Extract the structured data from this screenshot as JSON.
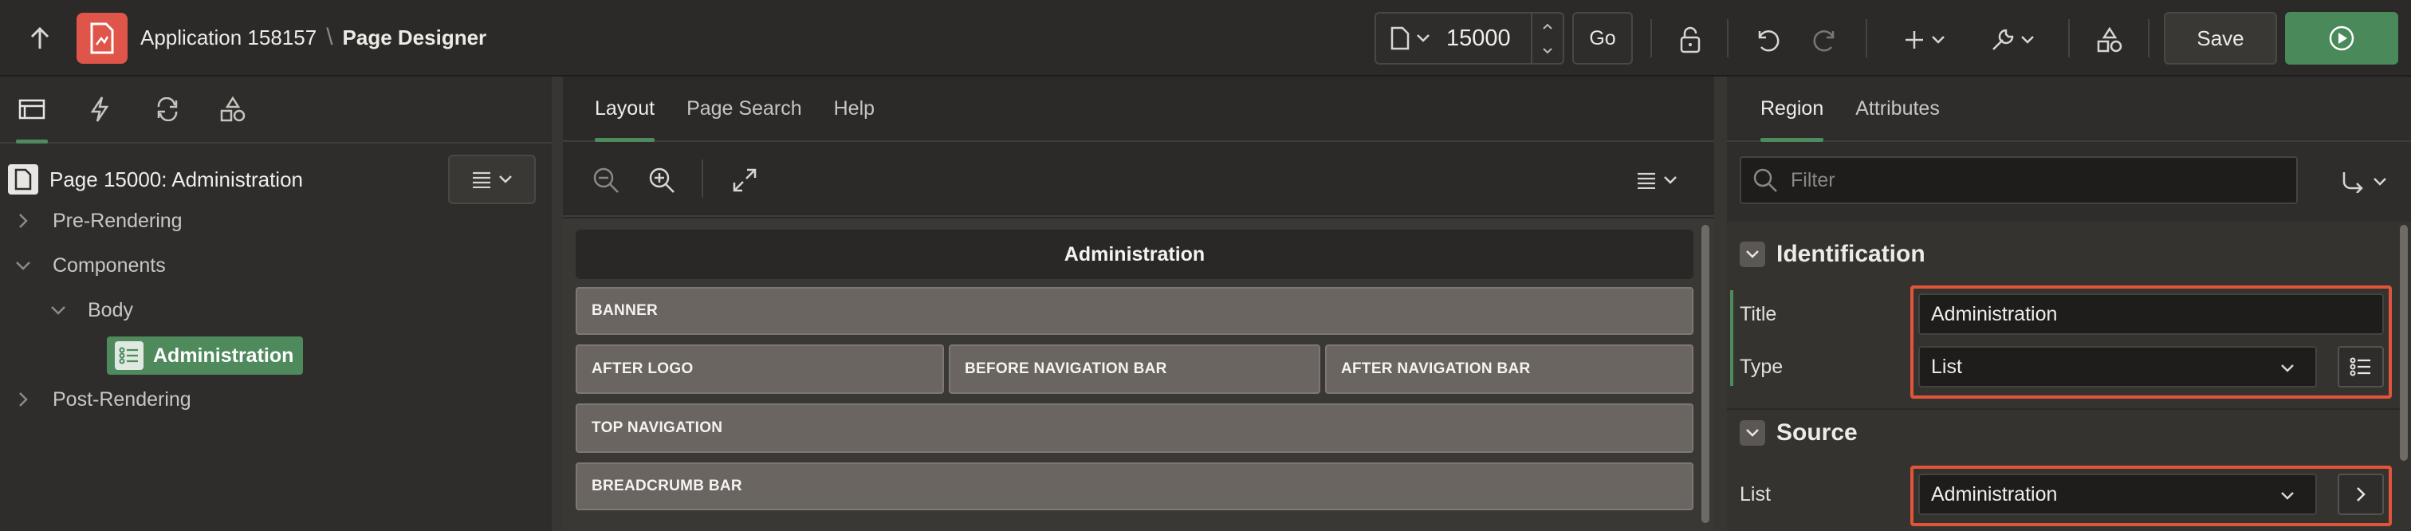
{
  "topbar": {
    "app_name": "Application 158157",
    "separator": "\\",
    "page_label": "Page Designer",
    "page_number": "15000",
    "go_label": "Go",
    "save_label": "Save"
  },
  "left_pane": {
    "tabs": [
      "rendering-icon",
      "dynamic-actions-icon",
      "processing-icon",
      "shared-components-icon"
    ],
    "page_title": "Page 15000: Administration",
    "tree": {
      "pre_rendering": "Pre-Rendering",
      "components": "Components",
      "body": "Body",
      "region": "Administration",
      "post_rendering": "Post-Rendering"
    }
  },
  "center_pane": {
    "tabs": [
      "Layout",
      "Page Search",
      "Help"
    ],
    "active_tab": "Layout",
    "page_name": "Administration",
    "slots": {
      "banner": "BANNER",
      "after_logo": "AFTER LOGO",
      "before_nav": "BEFORE NAVIGATION BAR",
      "after_nav": "AFTER NAVIGATION BAR",
      "top_nav": "TOP NAVIGATION",
      "breadcrumb": "BREADCRUMB BAR"
    }
  },
  "right_pane": {
    "tabs": [
      "Region",
      "Attributes"
    ],
    "active_tab": "Region",
    "filter_placeholder": "Filter",
    "identification": {
      "heading": "Identification",
      "title_label": "Title",
      "title_value": "Administration",
      "type_label": "Type",
      "type_value": "List"
    },
    "source": {
      "heading": "Source",
      "list_label": "List",
      "list_value": "Administration"
    }
  },
  "colors": {
    "accent_green": "#4e8a5c",
    "run_button": "#4a8a5a",
    "highlight": "#e0553a",
    "app_icon": "#e0554a"
  }
}
